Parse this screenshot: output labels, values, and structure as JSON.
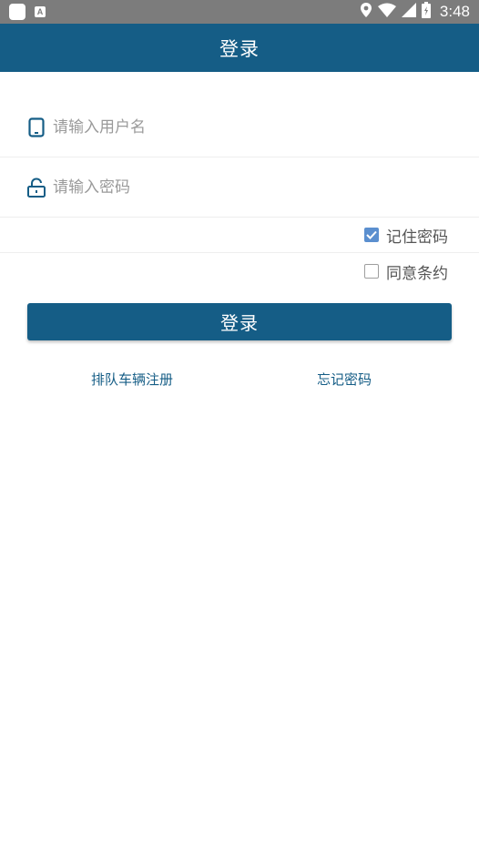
{
  "status_bar": {
    "time": "3:48",
    "left_icons": [
      "app-square-icon",
      "keyboard-a-icon"
    ],
    "right_icons": [
      "location-icon",
      "wifi-icon",
      "signal-icon",
      "battery-icon"
    ]
  },
  "app_bar": {
    "title": "登录"
  },
  "form": {
    "username": {
      "icon": "phone-icon",
      "placeholder": "请输入用户名",
      "value": ""
    },
    "password": {
      "icon": "unlock-icon",
      "placeholder": "请输入密码",
      "value": ""
    },
    "remember_password": {
      "label": "记住密码",
      "checked": true
    },
    "agree_terms": {
      "label": "同意条约",
      "checked": false
    },
    "login_button": "登录"
  },
  "links": {
    "register": "排队车辆注册",
    "forgot_password": "忘记密码"
  },
  "colors": {
    "primary": "#155d86",
    "status_bar": "#7c7c7c",
    "checkbox_checked": "#5b8fcf",
    "placeholder": "#9a9a9a"
  }
}
